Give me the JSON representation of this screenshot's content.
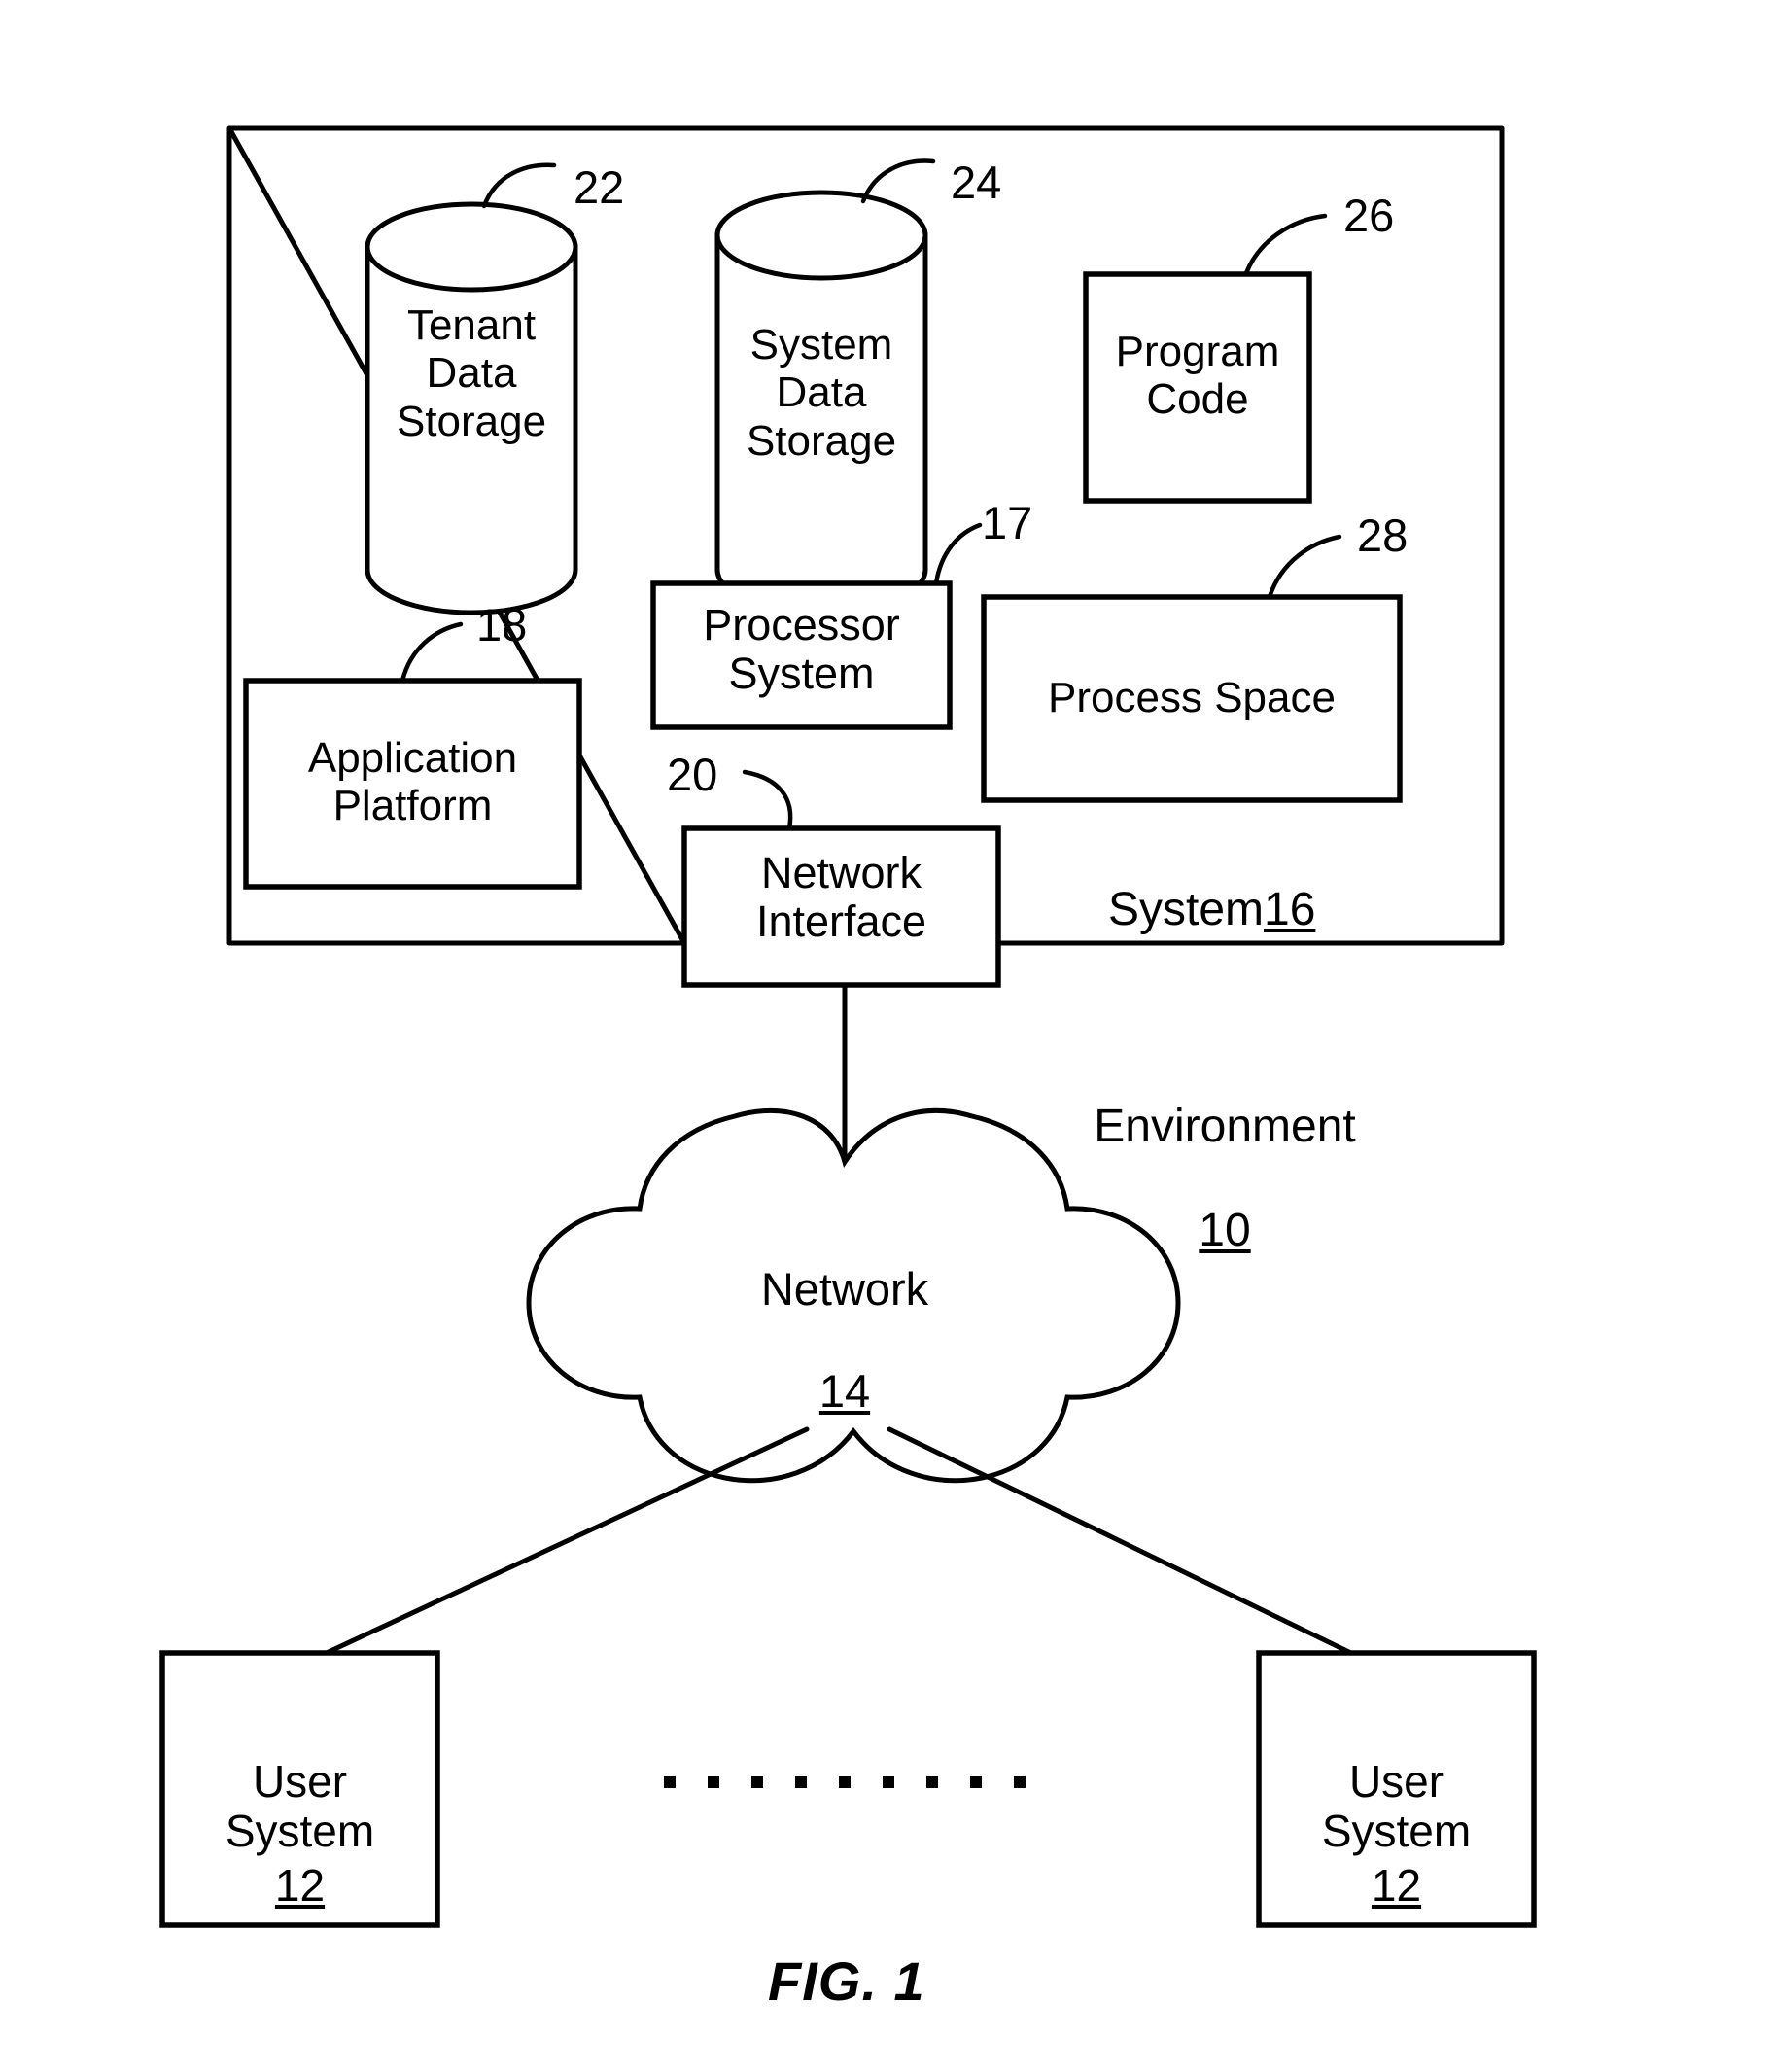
{
  "figure": {
    "caption": "FIG. 1",
    "title": "System architecture environment diagram"
  },
  "system_box": {
    "label_text": "System",
    "label_ref": "16"
  },
  "environment": {
    "label_text": "Environment",
    "label_ref": "10"
  },
  "nodes": {
    "tenant_data_storage": {
      "label": "Tenant\nData\nStorage",
      "ref": "22",
      "shape": "cylinder"
    },
    "system_data_storage": {
      "label": "System\nData\nStorage",
      "ref": "24",
      "shape": "cylinder"
    },
    "program_code": {
      "label": "Program\nCode",
      "ref": "26",
      "shape": "rectangle"
    },
    "processor_system": {
      "label": "Processor\nSystem",
      "ref": "17",
      "shape": "rectangle"
    },
    "process_space": {
      "label": "Process Space",
      "ref": "28",
      "shape": "rectangle"
    },
    "application_platform": {
      "label": "Application\nPlatform",
      "ref": "18",
      "shape": "rectangle"
    },
    "network_interface": {
      "label": "Network\nInterface",
      "ref": "20",
      "shape": "rectangle"
    },
    "network_cloud": {
      "label": "Network",
      "ref": "14",
      "shape": "cloud"
    },
    "user_system_left": {
      "label": "User\nSystem",
      "ref": "12",
      "shape": "rectangle"
    },
    "user_system_right": {
      "label": "User\nSystem",
      "ref": "12",
      "shape": "rectangle"
    }
  },
  "ellipsis": {
    "symbol": "·",
    "count": 9
  },
  "colors": {
    "line": "#000000",
    "fill": "#ffffff",
    "text": "#000000"
  }
}
